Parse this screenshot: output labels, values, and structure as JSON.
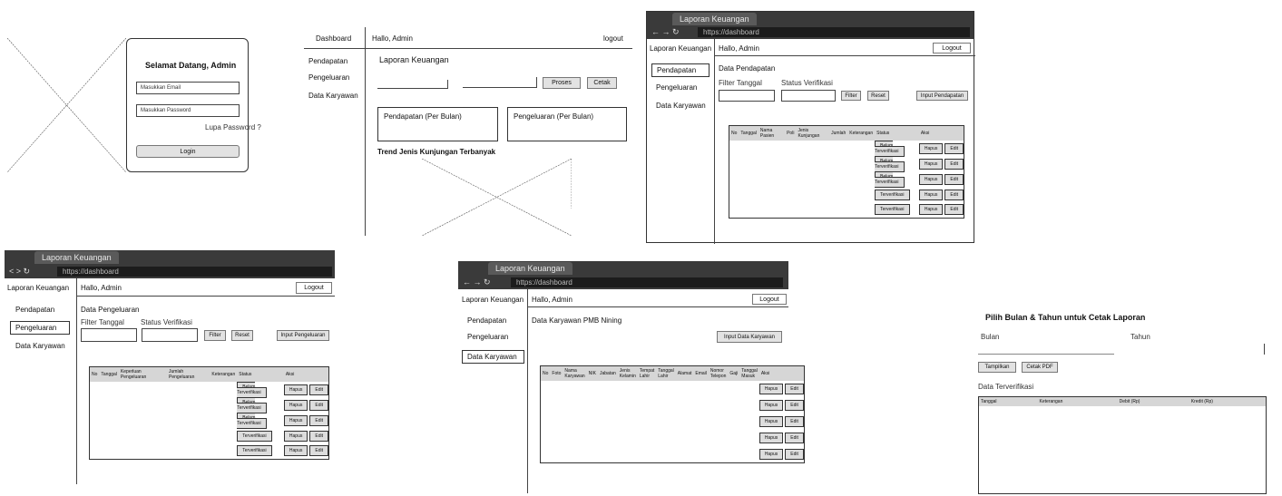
{
  "login": {
    "title": "Selamat Datang, Admin",
    "email_placeholder": "Masukkan Email",
    "password_placeholder": "Masukkan Password",
    "forgot": "Lupa Password ?",
    "login_btn": "Login"
  },
  "dashboard": {
    "nav_title": "Dashboard",
    "hello": "Hallo, Admin",
    "logout": "logout",
    "menu": [
      "Pendapatan",
      "Pengeluaran",
      "Data Karyawan"
    ],
    "heading": "Laporan Keuangan",
    "proses": "Proses",
    "cetak": "Cetak",
    "card_income": "Pendapatan (Per Bulan)",
    "card_expense": "Pengeluaran (Per Bulan)",
    "trend": "Trend Jenis Kunjungan Terbanyak"
  },
  "browser": {
    "tab": "Laporan Keuangan",
    "url": "https://dashboard"
  },
  "common": {
    "brand": "Laporan Keuangan",
    "hello": "Hallo, Admin",
    "logout": "Logout",
    "menu": [
      "Pendapatan",
      "Pengeluaran",
      "Data Karyawan"
    ],
    "filter_date": "Filter Tanggal",
    "status_filter": "Status Verifikasi",
    "filter_btn": "Filter",
    "reset_btn": "Reset",
    "hapus": "Hapus",
    "edit": "Edit"
  },
  "income": {
    "title": "Data Pendapatan",
    "input_btn": "Input Pendapatan",
    "columns": [
      "No",
      "Tanggal",
      "Nama Pasien",
      "Poli",
      "Jenis Kunjungan",
      "Jumlah",
      "Keterangan",
      "Status",
      "Aksi"
    ],
    "statuses": [
      "Belum Terverifikasi",
      "Belum Terverifikasi",
      "Belum Terverifikasi",
      "Terverifikasi",
      "Terverifikasi"
    ]
  },
  "expense": {
    "title": "Data Pengeluaran",
    "input_btn": "Input Pengeluaran",
    "columns": [
      "No",
      "Tanggal",
      "Keperluan Pengeluaran",
      "Jumlah Pengeluaran",
      "Keterangan",
      "Status",
      "Aksi"
    ],
    "statuses": [
      "Belum Terverifikasi",
      "Belum Terverifikasi",
      "Belum Terverifikasi",
      "Terverifikasi",
      "Terverifikasi"
    ]
  },
  "employees": {
    "title": "Data Karyawan PMB Nining",
    "input_btn": "Input Data Karyawan",
    "columns": [
      "No",
      "Foto",
      "Nama Karyawan",
      "NIK",
      "Jabatan",
      "Jenis Kelamin",
      "Tempat Lahir",
      "Tanggal Lahir",
      "Alamat",
      "Email",
      "Nomor Telepon",
      "Gaji",
      "Tanggal Masuk",
      "Aksi"
    ]
  },
  "print": {
    "title": "Pilih Bulan & Tahun untuk Cetak Laporan",
    "bulan": "Bulan",
    "tahun": "Tahun",
    "tampilkan": "Tampilkan",
    "cetak_pdf": "Cetak PDF",
    "subtitle": "Data Terverifikasi",
    "columns": [
      "Tanggal",
      "Keterangan",
      "Debit (Rp)",
      "Kredit (Rp)"
    ]
  }
}
